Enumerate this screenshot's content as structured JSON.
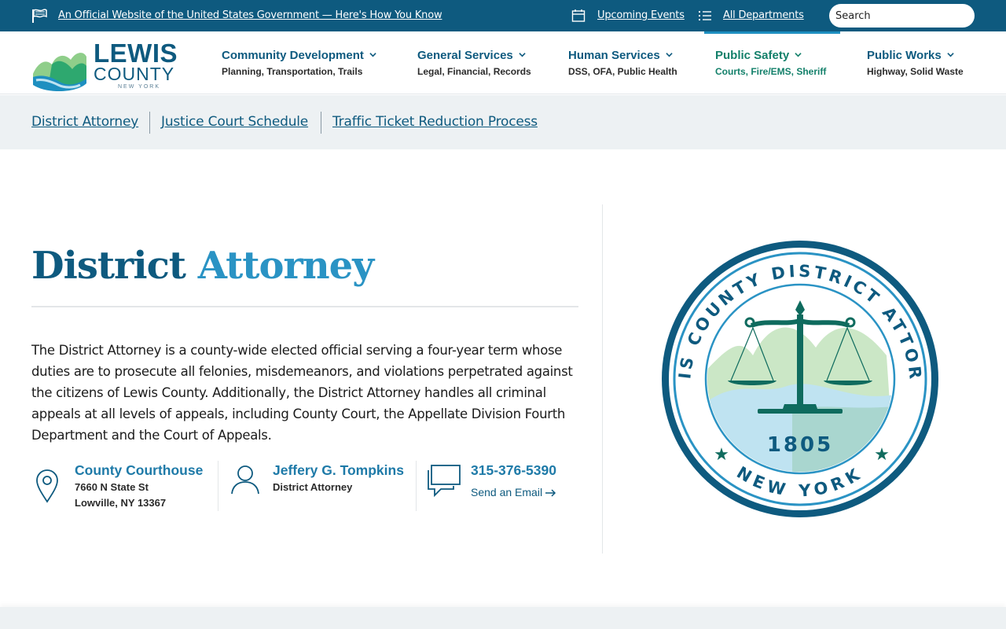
{
  "gov_banner": {
    "official_text": "An Official Website of the United States Government — Here's How You Know",
    "events_label": "Upcoming Events",
    "departments_label": "All Departments",
    "search_placeholder": "Search"
  },
  "logo": {
    "line1": "LEWIS",
    "line2": "COUNTY",
    "line3": "NEW YORK"
  },
  "nav": [
    {
      "title": "Community Development",
      "subtitle": "Planning, Transportation, Trails",
      "active": false
    },
    {
      "title": "General Services",
      "subtitle": "Legal, Financial, Records",
      "active": false
    },
    {
      "title": "Human Services",
      "subtitle": "DSS, OFA, Public Health",
      "active": false
    },
    {
      "title": "Public Safety",
      "subtitle": "Courts, Fire/EMS, Sheriff",
      "active": true
    },
    {
      "title": "Public Works",
      "subtitle": "Highway, Solid Waste",
      "active": false
    }
  ],
  "subnav": [
    "District Attorney",
    "Justice Court Schedule",
    "Traffic Ticket Reduction Process"
  ],
  "page": {
    "title_part1": "District",
    "title_part2": "Attorney",
    "intro": "The District Attorney is a county-wide elected official serving a four-year term whose duties are to prosecute all felonies, misdemeanors, and violations perpetrated against the citizens of Lewis County. Additionally, the District Attorney handles all criminal appeals at all levels of appeals, including County Court, the Appellate Division Fourth Department and the Court of Appeals."
  },
  "contacts": {
    "location": {
      "title": "County Courthouse",
      "line1": "7660 N State St",
      "line2": "Lowville, NY 13367"
    },
    "person": {
      "name": "Jeffery G. Tompkins",
      "role": "District Attorney"
    },
    "phone": {
      "number": "315-376-5390",
      "email_label": "Send an Email"
    }
  },
  "seal": {
    "top_text": "LEWIS COUNTY DISTRICT ATTORNEY",
    "bottom_text": "NEW YORK",
    "year": "1805"
  },
  "colors": {
    "brand_blue": "#0e5a7f",
    "accent_blue": "#2a93c4",
    "active_green": "#13806a",
    "seal_green": "#0f6b5e",
    "banner_bg": "#0e5a7f",
    "subnav_bg": "#edf1f3"
  },
  "icons": [
    "flag-icon",
    "calendar-icon",
    "list-icon",
    "chevron-down-icon",
    "location-pin-icon",
    "person-icon",
    "chat-icon",
    "arrow-right-icon"
  ]
}
